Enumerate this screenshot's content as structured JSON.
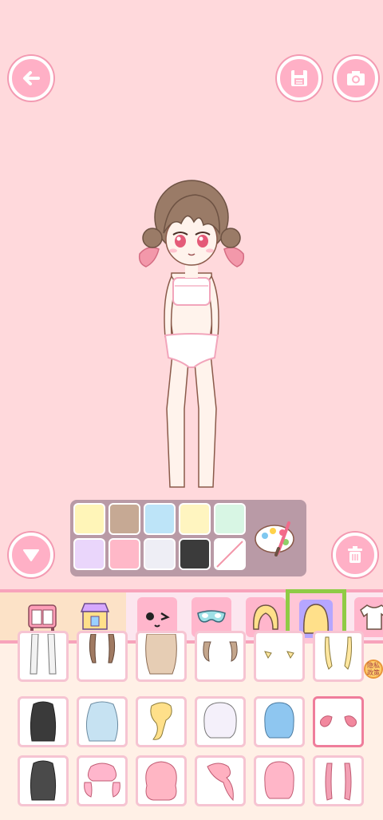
{
  "toolbar": {
    "back": "arrow-left-icon",
    "save": "floppy-disk-icon",
    "camera": "camera-icon",
    "collapse": "triangle-down-icon",
    "trash": "trash-icon"
  },
  "palette": {
    "colors": [
      "#fff5b8",
      "#c6a994",
      "#bde4f8",
      "#fff5c0",
      "#d8f6e4",
      "#ead6fb",
      "#ffb8c8",
      "#eeeef5",
      "#3b3b3b",
      "none"
    ],
    "tool": "paint-palette-icon"
  },
  "categories": [
    {
      "icon": "wardrobe-icon"
    },
    {
      "icon": "shop-icon"
    },
    {
      "icon": "face-icon"
    },
    {
      "icon": "mask-icon"
    },
    {
      "icon": "bangs-icon"
    },
    {
      "icon": "back-hair-icon",
      "selected": true
    },
    {
      "icon": "shirt-icon"
    }
  ],
  "badge": {
    "line1": "隐私",
    "line2": "政策"
  },
  "hair_items": [
    "long-straight-white",
    "twin-braids-brown",
    "long-wavy-beige",
    "short-curls-brown",
    "bangs-strands-yellow",
    "strands-yellow",
    "long-black",
    "wavy-blue",
    "side-ponytail-yellow",
    "bob-white",
    "bob-blue",
    "twin-buns-pink",
    "long-black-2",
    "pigtails-pink",
    "curly-pink",
    "side-ponytail-pink",
    "bob-pink",
    "twin-tails-pink"
  ]
}
